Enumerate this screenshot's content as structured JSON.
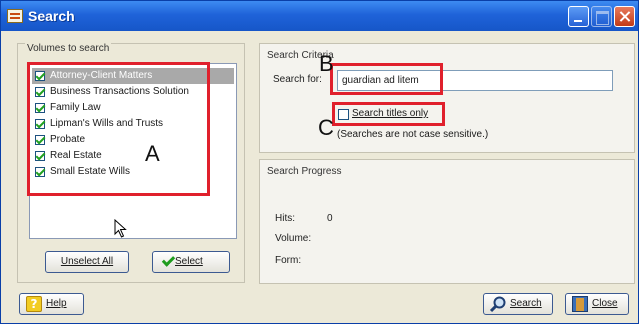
{
  "window": {
    "title": "Search"
  },
  "volumes": {
    "caption": "Volumes to search",
    "items": [
      {
        "label": "Attorney-Client Matters",
        "checked": true,
        "selected": true
      },
      {
        "label": "Business Transactions Solution",
        "checked": true,
        "selected": false
      },
      {
        "label": "Family Law",
        "checked": true,
        "selected": false
      },
      {
        "label": "Lipman's Wills and Trusts",
        "checked": true,
        "selected": false
      },
      {
        "label": "Probate",
        "checked": true,
        "selected": false
      },
      {
        "label": "Real Estate",
        "checked": true,
        "selected": false
      },
      {
        "label": "Small Estate Wills",
        "checked": true,
        "selected": false
      }
    ],
    "unselect_label": "Unselect All",
    "select_label": "Select"
  },
  "criteria": {
    "title": "Search Criteria",
    "search_for_label": "Search for:",
    "search_value": "guardian ad litem",
    "titles_only_label": "Search titles only",
    "titles_only_checked": false,
    "note": "(Searches are not case sensitive.)"
  },
  "progress": {
    "title": "Search Progress",
    "hits_label": "Hits:",
    "hits_value": "0",
    "volume_label": "Volume:",
    "form_label": "Form:"
  },
  "footer": {
    "help_label": "Help",
    "search_label": "Search",
    "close_label": "Close"
  },
  "annotations": {
    "a": "A",
    "b": "B",
    "c": "C",
    "color": "#e0202c"
  },
  "icons": {
    "app": "app-icon",
    "minimize": "minimize-icon",
    "maximize": "maximize-icon",
    "close": "close-icon",
    "check": "check-icon",
    "help": "question-mark-icon",
    "search": "magnifier-icon",
    "exit": "door-icon",
    "cursor": "mouse-pointer-icon"
  }
}
